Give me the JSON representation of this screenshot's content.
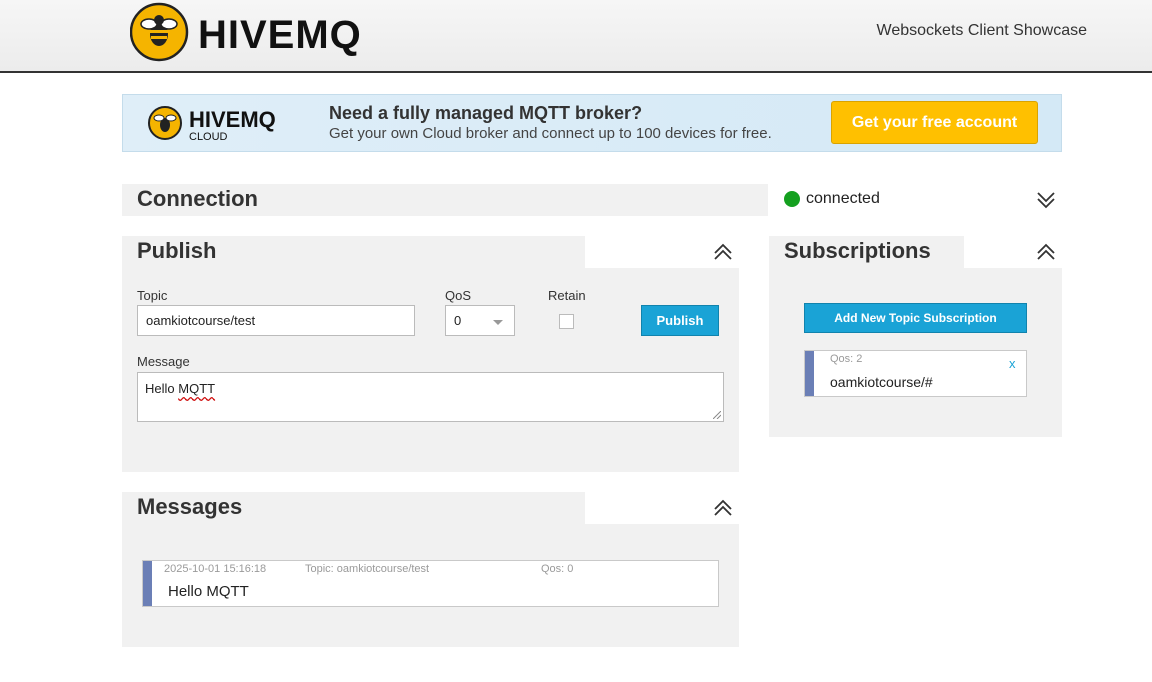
{
  "header": {
    "brand": "HIVEMQ",
    "title": "Websockets Client Showcase"
  },
  "banner": {
    "brand": "HIVEMQ",
    "brand_sub": "CLOUD",
    "headline": "Need a fully managed MQTT broker?",
    "subtext": "Get your own Cloud broker and connect up to 100 devices for free.",
    "cta_label": "Get your free account"
  },
  "connection": {
    "title": "Connection",
    "status": "connected",
    "status_color": "#14a01f",
    "toggle_icon": "chevron-double-down-icon"
  },
  "publish": {
    "title": "Publish",
    "toggle_icon": "chevron-double-up-icon",
    "topic_label": "Topic",
    "topic_value": "oamkiotcourse/test",
    "qos_label": "QoS",
    "qos_value": "0",
    "retain_label": "Retain",
    "retain_checked": false,
    "button_label": "Publish",
    "message_label": "Message",
    "message_value": "Hello MQTT",
    "message_prefix": "Hello ",
    "message_flagged": "MQTT"
  },
  "messages": {
    "title": "Messages",
    "toggle_icon": "chevron-double-up-icon",
    "items": [
      {
        "timestamp": "2025-10-01 15:16:18",
        "topic": "Topic: oamkiotcourse/test",
        "qos": "Qos: 0",
        "payload": "Hello MQTT"
      }
    ]
  },
  "subscriptions": {
    "title": "Subscriptions",
    "toggle_icon": "chevron-double-up-icon",
    "add_button_label": "Add New Topic Subscription",
    "items": [
      {
        "qos": "Qos: 2",
        "topic": "oamkiotcourse/#",
        "remove_label": "x"
      }
    ]
  },
  "colors": {
    "accent": "#1aa3d6",
    "cta": "#ffc000",
    "stripe": "#6b7fb6",
    "brand": "#f5b400"
  }
}
